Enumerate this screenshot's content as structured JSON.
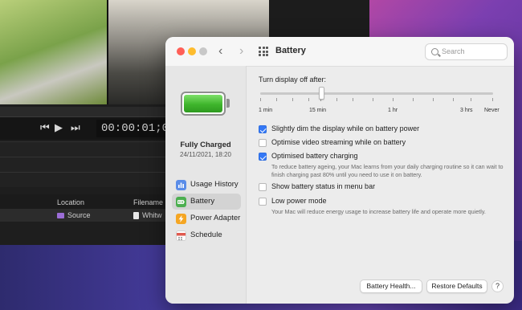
{
  "background_app": {
    "timecode": "00:00:01;05",
    "table_headers": {
      "location": "Location",
      "filename": "Filename"
    },
    "table_row": {
      "location": "Source",
      "filename": "Whitw"
    }
  },
  "window": {
    "title": "Battery",
    "search_placeholder": "Search"
  },
  "sidebar": {
    "status_title": "Fully Charged",
    "status_date": "24/11/2021, 18:20",
    "items": [
      {
        "label": "Usage History",
        "icon": "bar-chart-icon",
        "color": "#5b8de8",
        "selected": false
      },
      {
        "label": "Battery",
        "icon": "battery-icon",
        "color": "#4caf50",
        "selected": true
      },
      {
        "label": "Power Adapter",
        "icon": "bolt-icon",
        "color": "#f5a623",
        "selected": false
      },
      {
        "label": "Schedule",
        "icon": "calendar-icon",
        "color": "#e05a4f",
        "selected": false
      }
    ]
  },
  "content": {
    "display_off_label": "Turn display off after:",
    "slider_value": "15 min",
    "slider_labels": [
      "1 min",
      "15 min",
      "1 hr",
      "3 hrs",
      "Never"
    ],
    "options": [
      {
        "label": "Slightly dim the display while on battery power",
        "checked": true
      },
      {
        "label": "Optimise video streaming while on battery",
        "checked": false
      },
      {
        "label": "Optimised battery charging",
        "checked": true,
        "description": "To reduce battery ageing, your Mac learns from your daily charging routine so it can wait to finish charging past 80% until you need to use it on battery."
      },
      {
        "label": "Show battery status in menu bar",
        "checked": false
      },
      {
        "label": "Low power mode",
        "checked": false,
        "description": "Your Mac will reduce energy usage to increase battery life and operate more quietly."
      }
    ],
    "buttons": {
      "battery_health": "Battery Health...",
      "restore_defaults": "Restore Defaults",
      "help": "?"
    }
  },
  "colors": {
    "accent": "#3478f6",
    "close": "#ff5f57",
    "minimize": "#febc2e",
    "zoom": "#c8c8c8"
  }
}
